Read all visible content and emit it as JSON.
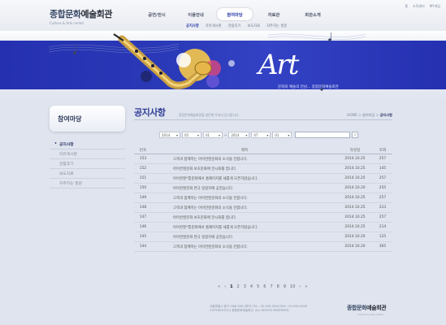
{
  "header": {
    "logo_main_a": "종합문화",
    "logo_main_b": "예술회관",
    "logo_sub": "Culture & Arts center",
    "util": [
      "홈",
      "조직센터",
      "MY게임"
    ],
    "gnb": [
      "공연/전시",
      "이용안내",
      "참여마당",
      "자료관",
      "회관소개"
    ],
    "lnb": [
      "공지사항",
      "자유게시판",
      "관람후기",
      "보도자료",
      "자주하는 질문"
    ]
  },
  "banner": {
    "art": "Art",
    "caption": "문화와 예술의 만남... 종합문화예술회관"
  },
  "sidebar": {
    "title": "참여마당",
    "items": [
      "공지사항",
      "자유게시판",
      "관람후기",
      "보도자료",
      "자주하는 질문"
    ]
  },
  "content": {
    "title": "공지사항",
    "desc": "종합문화예술회관을 방문해 주셔서 감사합니다.",
    "breadcrumb": [
      "HOME",
      "참여마당",
      "공지사항"
    ],
    "search": {
      "from": [
        "2014",
        "05",
        "01"
      ],
      "to": [
        "2014",
        "07",
        "01"
      ],
      "icon": "search-icon"
    },
    "columns": [
      "번호",
      "제목",
      "작성일",
      "조회"
    ],
    "rows": [
      {
        "no": "153",
        "title": "고객과 함께하는 아이컨텐문화의 소식을 전합니다.",
        "date": "2014.10.25",
        "views": "257"
      },
      {
        "no": "152",
        "title": "아이컨텐문화 보호문화에 전시회를 엽니다.",
        "date": "2014.10.25",
        "views": "145"
      },
      {
        "no": "151",
        "title": "아이컨텐*통문화에서 홈페이지를 새롭게 오픈하였습니다.",
        "date": "2014.10.25",
        "views": "257"
      },
      {
        "no": "150",
        "title": "아이컨텐문화 연극 일정지에 공헌습니다.",
        "date": "2014.10.20",
        "views": "255"
      },
      {
        "no": "149",
        "title": "고객과 함께하는 아이컨텐문화의 소식을 전합니다.",
        "date": "2014.10.25",
        "views": "257"
      },
      {
        "no": "148",
        "title": "고객과 함께하는 아이컨텐문화의 소식을 전합니다.",
        "date": "2014.10.25",
        "views": "223"
      },
      {
        "no": "147",
        "title": "아이컨텐문화 보호문화에 전시회를 엽니다.",
        "date": "2014.10.25",
        "views": "257"
      },
      {
        "no": "146",
        "title": "아이컨텐*통문화에서 홈페이지를 새롭게 오픈하였습니다.",
        "date": "2014.10.25",
        "views": "214"
      },
      {
        "no": "145",
        "title": "아이컨텐문화 연극 일정지에 공헌습니다.",
        "date": "2014.10.20",
        "views": "125"
      },
      {
        "no": "144",
        "title": "고객과 함께하는 아이컨텐문화의 소식을 전합니다.",
        "date": "2014.10.20",
        "views": "365"
      }
    ],
    "paging": {
      "first": "«",
      "prev": "‹",
      "pages": [
        "1",
        "2",
        "3",
        "4",
        "5",
        "6",
        "7",
        "8",
        "9",
        "10"
      ],
      "next": "›",
      "last": "»"
    }
  },
  "footer": {
    "line1": "서울특별시 중구 00로 000-0번지 TEL : 00-000-0000 FAX : 00-000-0000",
    "line2": "COPYRIGHT(C) 종합문화예술회관. ALL RIGHTS RESERVED.",
    "logo_a": "종합문화",
    "logo_b": "예술회관",
    "logo_sub": "Culture & Arts center"
  },
  "colors": {
    "accent": "#2b3fa8",
    "band": "#2a38b8",
    "bg": "#dfe4ee"
  }
}
